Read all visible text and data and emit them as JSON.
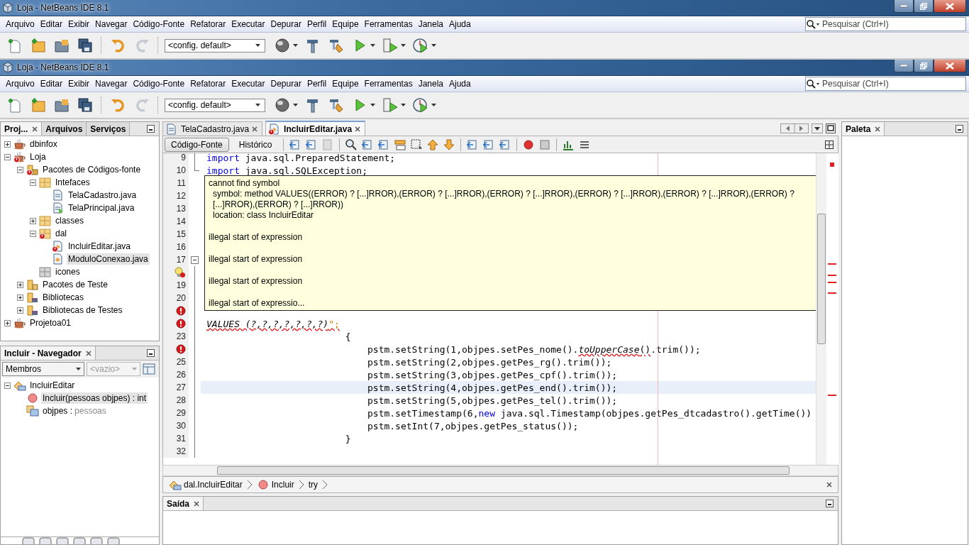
{
  "windows": [
    {
      "title": "Loja - NetBeans IDE 8.1",
      "menu": [
        "Arquivo",
        "Editar",
        "Exibir",
        "Navegar",
        "Código-Fonte",
        "Refatorar",
        "Executar",
        "Depurar",
        "Perfil",
        "Equipe",
        "Ferramentas",
        "Janela",
        "Ajuda"
      ],
      "search": {
        "placeholder": "Pesquisar (Ctrl+I)"
      },
      "toolbar": {
        "config": "<config. default>",
        "buttons": [
          {
            "disabled": false
          },
          {
            "disabled": false
          },
          {
            "disabled": false
          },
          {
            "disabled": false
          },
          {
            "disabled": false
          },
          {
            "disabled": true
          },
          {
            "disabled": false
          },
          {
            "disabled": false
          },
          {
            "disabled": false
          },
          {
            "disabled": false
          },
          {
            "disabled": false
          },
          {
            "disabled": false
          }
        ]
      }
    },
    {
      "title": "Loja - NetBeans IDE 8.1",
      "menu": [
        "Arquivo",
        "Editar",
        "Exibir",
        "Navegar",
        "Código-Fonte",
        "Refatorar",
        "Executar",
        "Depurar",
        "Perfil",
        "Equipe",
        "Ferramentas",
        "Janela",
        "Ajuda"
      ],
      "search": {
        "placeholder": "Pesquisar (Ctrl+I)"
      },
      "toolbar": {
        "config": "<config. default>",
        "buttons": [
          {
            "disabled": false
          },
          {
            "disabled": false
          },
          {
            "disabled": false
          },
          {
            "disabled": false
          },
          {
            "disabled": false
          },
          {
            "disabled": true
          },
          {
            "disabled": false
          },
          {
            "disabled": false
          },
          {
            "disabled": false
          },
          {
            "disabled": false
          },
          {
            "disabled": false
          },
          {
            "disabled": false
          }
        ]
      }
    }
  ],
  "projects_panel": {
    "tabs": [
      {
        "label": "Proj...",
        "selected": true
      },
      {
        "label": "Arquivos",
        "selected": false
      },
      {
        "label": "Serviços",
        "selected": false
      }
    ],
    "tree": [
      {
        "label": "dbinfox",
        "kind": "project",
        "error": false,
        "selected": false,
        "expanded": false
      },
      {
        "label": "Loja",
        "kind": "project",
        "error": true,
        "selected": false,
        "expanded": true,
        "children": [
          {
            "label": "Pacotes de Códigos-fonte",
            "kind": "source-folder",
            "error": true,
            "selected": false,
            "expanded": true,
            "children": [
              {
                "label": "Intefaces",
                "kind": "package",
                "error": false,
                "selected": false,
                "expanded": true,
                "children": [
                  {
                    "label": "TelaCadastro.java",
                    "kind": "form-file",
                    "error": false,
                    "selected": false
                  },
                  {
                    "label": "TelaPrincipal.java",
                    "kind": "main-form-file",
                    "error": false,
                    "selected": false
                  }
                ]
              },
              {
                "label": "classes",
                "kind": "package",
                "error": false,
                "selected": false,
                "expanded": false
              },
              {
                "label": "dal",
                "kind": "package",
                "error": true,
                "selected": false,
                "expanded": true,
                "children": [
                  {
                    "label": "IncluirEditar.java",
                    "kind": "class-file",
                    "error": true,
                    "selected": false
                  },
                  {
                    "label": "ModuloConexao.java",
                    "kind": "class-file",
                    "error": false,
                    "selected": true
                  }
                ]
              },
              {
                "label": "icones",
                "kind": "empty-package",
                "error": false,
                "selected": false
              }
            ]
          },
          {
            "label": "Pacotes de Teste",
            "kind": "test-folder",
            "error": false,
            "selected": false,
            "expanded": false
          },
          {
            "label": "Bibliotecas",
            "kind": "library",
            "error": false,
            "selected": false,
            "expanded": false
          },
          {
            "label": "Bibliotecas de Testes",
            "kind": "library",
            "error": false,
            "selected": false,
            "expanded": false
          }
        ]
      },
      {
        "label": "Projetoa01",
        "kind": "project",
        "error": false,
        "selected": false,
        "expanded": false
      }
    ]
  },
  "navigator": {
    "title": "Incluir - Navegador",
    "filter": "Membros",
    "scope": {
      "value": "<vazio>",
      "disabled": true
    },
    "tree": [
      {
        "label": "IncluirEditar",
        "kind": "class",
        "selected": false,
        "expanded": true,
        "children": [
          {
            "label": "Incluir(pessoas objpes) : int",
            "kind": "method",
            "selected": true
          },
          {
            "label": "objpes :",
            "type": "pessoas",
            "kind": "field",
            "selected": false
          }
        ]
      }
    ]
  },
  "editor": {
    "tabs": [
      {
        "label": "TelaCadastro.java",
        "selected": false,
        "error": false
      },
      {
        "label": "IncluirEditar.java",
        "selected": true,
        "error": true
      }
    ],
    "views": [
      {
        "label": "Código-Fonte",
        "selected": true
      },
      {
        "label": "Histórico",
        "selected": false
      }
    ],
    "lines": [
      {
        "number": "9",
        "kind": "number",
        "fold_start": false,
        "fold_end": false,
        "highlighted": false,
        "segments": [
          {
            "t": "import",
            "kind": "keyword"
          },
          {
            "t": " java.sql.PreparedStatement;",
            "kind": "plain"
          }
        ]
      },
      {
        "number": "10",
        "kind": "number",
        "fold_start": false,
        "fold_end": true,
        "highlighted": false,
        "segments": [
          {
            "t": "import",
            "kind": "keyword"
          },
          {
            "t": " java.sql.SQLException;",
            "kind": "plain"
          }
        ]
      },
      {
        "number": "11",
        "kind": "number",
        "fold_start": false,
        "fold_end": false,
        "highlighted": false
      },
      {
        "number": "12",
        "kind": "number",
        "fold_start": false,
        "fold_end": false,
        "highlighted": false
      },
      {
        "number": "13",
        "kind": "number",
        "fold_start": false,
        "fold_end": false,
        "highlighted": false
      },
      {
        "number": "14",
        "kind": "number",
        "fold_start": false,
        "fold_end": false,
        "highlighted": false
      },
      {
        "number": "15",
        "kind": "number",
        "fold_start": false,
        "fold_end": false,
        "highlighted": false
      },
      {
        "number": "16",
        "kind": "number",
        "fold_start": false,
        "fold_end": false,
        "highlighted": false
      },
      {
        "number": "17",
        "kind": "number",
        "fold_start": true,
        "fold_end": false,
        "highlighted": false
      },
      {
        "kind": "hint-error",
        "fold_start": false,
        "fold_end": false,
        "highlighted": false
      },
      {
        "number": "19",
        "kind": "number",
        "fold_start": false,
        "fold_end": false,
        "highlighted": false
      },
      {
        "number": "20",
        "kind": "number",
        "fold_start": false,
        "fold_end": false,
        "highlighted": false
      },
      {
        "kind": "error",
        "fold_start": false,
        "fold_end": false,
        "highlighted": false
      },
      {
        "kind": "error",
        "fold_start": false,
        "fold_end": false,
        "highlighted": false,
        "segments": [
          {
            "t": "VALUES (?,?,?,?,?,?,?)",
            "kind": "italic-error"
          },
          {
            "t": "\";",
            "kind": "string-error"
          }
        ]
      },
      {
        "number": "23",
        "kind": "number",
        "fold_start": false,
        "fold_end": false,
        "highlighted": false,
        "segments": [
          {
            "t": "                         {",
            "kind": "plain"
          }
        ]
      },
      {
        "kind": "error",
        "fold_start": false,
        "fold_end": false,
        "highlighted": false,
        "segments": [
          {
            "t": "                             pstm.setString(1,objpes.setPes_nome().",
            "kind": "plain"
          },
          {
            "t": "toUpperCase",
            "kind": "italic-error"
          },
          {
            "t": "()",
            "kind": "error"
          },
          {
            "t": ".trim());",
            "kind": "plain"
          }
        ]
      },
      {
        "number": "25",
        "kind": "number",
        "fold_start": false,
        "fold_end": false,
        "highlighted": false,
        "segments": [
          {
            "t": "                             pstm.setString(2,objpes.getPes_rg().trim());",
            "kind": "plain"
          }
        ]
      },
      {
        "number": "26",
        "kind": "number",
        "fold_start": false,
        "fold_end": false,
        "highlighted": false,
        "segments": [
          {
            "t": "                             pstm.setString(3,objpes.getPes_cpf().trim());",
            "kind": "plain"
          }
        ]
      },
      {
        "number": "27",
        "kind": "number",
        "fold_start": false,
        "fold_end": false,
        "highlighted": true,
        "segments": [
          {
            "t": "                             pstm.setString(4,objpes.getPes_end().trim());",
            "kind": "plain"
          }
        ]
      },
      {
        "number": "28",
        "kind": "number",
        "fold_start": false,
        "fold_end": false,
        "highlighted": false,
        "segments": [
          {
            "t": "                             pstm.setString(5,objpes.getPes_tel().trim());",
            "kind": "plain"
          }
        ]
      },
      {
        "number": "29",
        "kind": "number",
        "fold_start": false,
        "fold_end": false,
        "highlighted": false,
        "segments": [
          {
            "t": "                             pstm.setTimestamp(6,",
            "kind": "plain"
          },
          {
            "t": "new",
            "kind": "keyword"
          },
          {
            "t": " java.sql.Timestamp(objpes.getPes_dtcadastro().getTime())",
            "kind": "plain"
          }
        ]
      },
      {
        "number": "30",
        "kind": "number",
        "fold_start": false,
        "fold_end": false,
        "highlighted": false,
        "segments": [
          {
            "t": "                             pstm.setInt(7,objpes.getPes_status());",
            "kind": "plain"
          }
        ]
      },
      {
        "number": "31",
        "kind": "number",
        "fold_start": false,
        "fold_end": false,
        "highlighted": false,
        "segments": [
          {
            "t": "                         }",
            "kind": "plain"
          }
        ]
      },
      {
        "number": "32",
        "kind": "number",
        "fold_start": false,
        "fold_end": false,
        "highlighted": false
      }
    ],
    "tooltip": [
      [
        "cannot find symbol",
        "symbol:   method VALUES((ERROR) ? [...]RROR),(ERROR) ? [...]RROR),(ERROR) ? [...]RROR),(ERROR) ? [...]RROR),(ERROR) ? [...]RROR),(ERROR) ? [...]RROR),(ERROR) ? [...]RROR))",
        "location: class IncluirEditar"
      ],
      [
        "illegal start of expression"
      ],
      [
        "illegal start of expression"
      ],
      [
        "illegal start of expression"
      ],
      [
        "illegal start of expressio..."
      ]
    ],
    "breadcrumbs": [
      {
        "label": "dal.IncluirEditar",
        "kind": "class"
      },
      {
        "label": "Incluir",
        "kind": "method"
      },
      {
        "label": "try",
        "kind": "block"
      }
    ]
  },
  "output": {
    "title": "Saída"
  },
  "palette": {
    "title": "Paleta"
  }
}
